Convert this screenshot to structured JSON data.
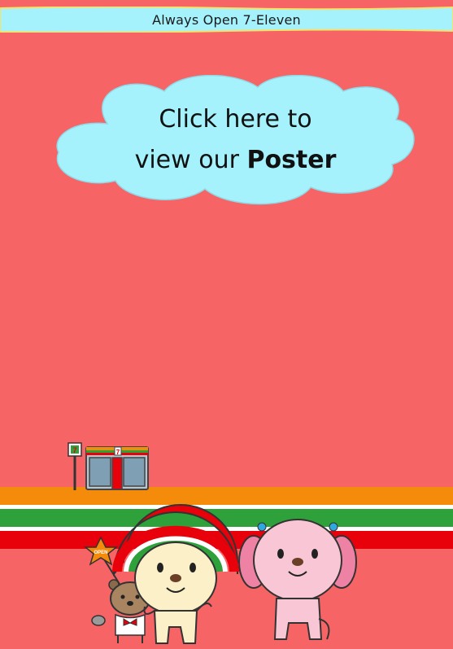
{
  "header": {
    "title": "Always Open 7-Eleven"
  },
  "cta": {
    "line1": "Click here to",
    "line2_prefix": "view our ",
    "line2_bold": "Poster"
  },
  "illustration": {
    "star_label": "OPEN",
    "sign_label": "7",
    "store_label": "7"
  },
  "colors": {
    "background": "#f76466",
    "header_band": "#a6f2fc",
    "cloud": "#a6f2fc",
    "stripe_orange": "#f58b0a",
    "stripe_green": "#2ea13a",
    "stripe_red": "#e8000b"
  }
}
